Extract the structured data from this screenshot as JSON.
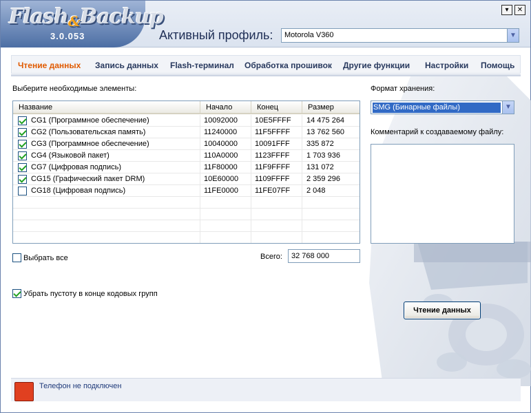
{
  "app": {
    "logo_main": "Flash",
    "logo_amp": "&",
    "logo_second": "Backup",
    "version": "3.0.053"
  },
  "window_controls": {
    "minimize_glyph": "▾",
    "close_glyph": "✕"
  },
  "header": {
    "profile_label": "Активный профиль:",
    "profile_value": "Motorola V360"
  },
  "menu": {
    "items": [
      "Чтение данных",
      "Запись данных",
      "Flash-терминал",
      "Обработка прошивок",
      "Другие функции",
      "Настройки",
      "Помощь"
    ],
    "active_index": 0
  },
  "left": {
    "select_label": "Выберите необходимые элементы:",
    "columns": [
      "Название",
      "Начало",
      "Конец",
      "Размер"
    ],
    "rows": [
      {
        "name": "CG1 (Программное обеспечение)",
        "start": "10092000",
        "end": "10E5FFFF",
        "size": "14 475 264",
        "checked": true
      },
      {
        "name": "CG2 (Пользовательская память)",
        "start": "11240000",
        "end": "11F5FFFF",
        "size": "13 762 560",
        "checked": true
      },
      {
        "name": "CG3 (Программное обеспечение)",
        "start": "10040000",
        "end": "10091FFF",
        "size": "335 872",
        "checked": true
      },
      {
        "name": "CG4 (Языковой пакет)",
        "start": "110A0000",
        "end": "1123FFFF",
        "size": "1 703 936",
        "checked": true
      },
      {
        "name": "CG7 (Цифровая подпись)",
        "start": "11F80000",
        "end": "11F9FFFF",
        "size": "131 072",
        "checked": true
      },
      {
        "name": "CG15 (Графический пакет DRM)",
        "start": "10E60000",
        "end": "1109FFFF",
        "size": "2 359 296",
        "checked": true
      },
      {
        "name": "CG18 (Цифровая подпись)",
        "start": "11FE0000",
        "end": "11FE07FF",
        "size": "2 048",
        "checked": false
      }
    ],
    "empty_rows": 4,
    "select_all_label": "Выбрать все",
    "select_all_checked": false,
    "total_label": "Всего:",
    "total_value": "32 768 000",
    "trim_label": "Убрать пустоту в конце кодовых групп",
    "trim_checked": true
  },
  "right": {
    "format_label": "Формат хранения:",
    "format_value": "SMG (Бинарные файлы)",
    "comment_label": "Комментарий к создаваемому файлу:",
    "comment_value": "",
    "read_button": "Чтение данных"
  },
  "status": {
    "text": "Телефон не подключен",
    "led_color": "#e04020"
  },
  "colors": {
    "accent": "#e05a00",
    "menu_text": "#28395e",
    "selection": "#316ac5"
  }
}
